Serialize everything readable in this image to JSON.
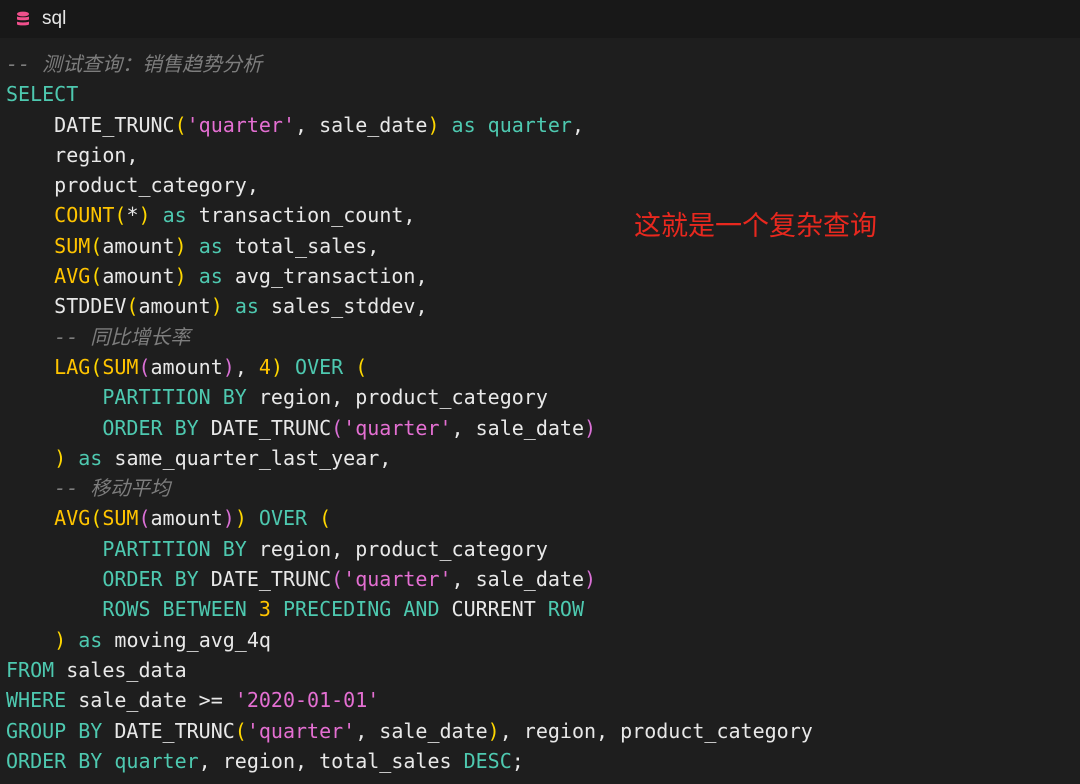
{
  "tab": {
    "icon": "database-icon",
    "label": "sql"
  },
  "annotation": "这就是一个复杂查询",
  "colors": {
    "background": "#1e1e1e",
    "titlebar": "#181818",
    "keyword": "#4ec9b0",
    "function": "#ffc400",
    "string": "#e46fd2",
    "comment": "#7d7d7d",
    "annotation": "#e8281e"
  },
  "code": {
    "lines": [
      [
        {
          "t": "comment",
          "v": "-- 测试查询：销售趋势分析"
        }
      ],
      [
        {
          "t": "keyword",
          "v": "SELECT"
        }
      ],
      [
        {
          "t": "plain",
          "v": "    DATE_TRUNC"
        },
        {
          "t": "paren1",
          "v": "("
        },
        {
          "t": "string",
          "v": "'quarter'"
        },
        {
          "t": "plain",
          "v": ", sale_date"
        },
        {
          "t": "paren1",
          "v": ")"
        },
        {
          "t": "plain",
          "v": " "
        },
        {
          "t": "keyword",
          "v": "as quarter"
        },
        {
          "t": "plain",
          "v": ","
        }
      ],
      [
        {
          "t": "plain",
          "v": "    region,"
        }
      ],
      [
        {
          "t": "plain",
          "v": "    product_category,"
        }
      ],
      [
        {
          "t": "plain",
          "v": "    "
        },
        {
          "t": "func",
          "v": "COUNT"
        },
        {
          "t": "paren1",
          "v": "("
        },
        {
          "t": "plain",
          "v": "*"
        },
        {
          "t": "paren1",
          "v": ")"
        },
        {
          "t": "plain",
          "v": " "
        },
        {
          "t": "keyword",
          "v": "as"
        },
        {
          "t": "plain",
          "v": " transaction_count,"
        }
      ],
      [
        {
          "t": "plain",
          "v": "    "
        },
        {
          "t": "func",
          "v": "SUM"
        },
        {
          "t": "paren1",
          "v": "("
        },
        {
          "t": "plain",
          "v": "amount"
        },
        {
          "t": "paren1",
          "v": ")"
        },
        {
          "t": "plain",
          "v": " "
        },
        {
          "t": "keyword",
          "v": "as"
        },
        {
          "t": "plain",
          "v": " total_sales,"
        }
      ],
      [
        {
          "t": "plain",
          "v": "    "
        },
        {
          "t": "func",
          "v": "AVG"
        },
        {
          "t": "paren1",
          "v": "("
        },
        {
          "t": "plain",
          "v": "amount"
        },
        {
          "t": "paren1",
          "v": ")"
        },
        {
          "t": "plain",
          "v": " "
        },
        {
          "t": "keyword",
          "v": "as"
        },
        {
          "t": "plain",
          "v": " avg_transaction,"
        }
      ],
      [
        {
          "t": "plain",
          "v": "    STDDEV"
        },
        {
          "t": "paren1",
          "v": "("
        },
        {
          "t": "plain",
          "v": "amount"
        },
        {
          "t": "paren1",
          "v": ")"
        },
        {
          "t": "plain",
          "v": " "
        },
        {
          "t": "keyword",
          "v": "as"
        },
        {
          "t": "plain",
          "v": " sales_stddev,"
        }
      ],
      [
        {
          "t": "comment",
          "v": "    -- 同比增长率"
        }
      ],
      [
        {
          "t": "plain",
          "v": "    "
        },
        {
          "t": "func",
          "v": "LAG"
        },
        {
          "t": "paren1",
          "v": "("
        },
        {
          "t": "func",
          "v": "SUM"
        },
        {
          "t": "paren2",
          "v": "("
        },
        {
          "t": "plain",
          "v": "amount"
        },
        {
          "t": "paren2",
          "v": ")"
        },
        {
          "t": "plain",
          "v": ", "
        },
        {
          "t": "number",
          "v": "4"
        },
        {
          "t": "paren1",
          "v": ")"
        },
        {
          "t": "plain",
          "v": " "
        },
        {
          "t": "keyword",
          "v": "OVER"
        },
        {
          "t": "plain",
          "v": " "
        },
        {
          "t": "paren1",
          "v": "("
        }
      ],
      [
        {
          "t": "plain",
          "v": "        "
        },
        {
          "t": "keyword",
          "v": "PARTITION BY"
        },
        {
          "t": "plain",
          "v": " region, product_category"
        }
      ],
      [
        {
          "t": "plain",
          "v": "        "
        },
        {
          "t": "keyword",
          "v": "ORDER BY"
        },
        {
          "t": "plain",
          "v": " DATE_TRUNC"
        },
        {
          "t": "paren2",
          "v": "("
        },
        {
          "t": "string",
          "v": "'quarter'"
        },
        {
          "t": "plain",
          "v": ", sale_date"
        },
        {
          "t": "paren2",
          "v": ")"
        }
      ],
      [
        {
          "t": "plain",
          "v": "    "
        },
        {
          "t": "paren1",
          "v": ")"
        },
        {
          "t": "plain",
          "v": " "
        },
        {
          "t": "keyword",
          "v": "as"
        },
        {
          "t": "plain",
          "v": " same_quarter_last_year,"
        }
      ],
      [
        {
          "t": "comment",
          "v": "    -- 移动平均"
        }
      ],
      [
        {
          "t": "plain",
          "v": "    "
        },
        {
          "t": "func",
          "v": "AVG"
        },
        {
          "t": "paren1",
          "v": "("
        },
        {
          "t": "func",
          "v": "SUM"
        },
        {
          "t": "paren2",
          "v": "("
        },
        {
          "t": "plain",
          "v": "amount"
        },
        {
          "t": "paren2",
          "v": ")"
        },
        {
          "t": "paren1",
          "v": ")"
        },
        {
          "t": "plain",
          "v": " "
        },
        {
          "t": "keyword",
          "v": "OVER"
        },
        {
          "t": "plain",
          "v": " "
        },
        {
          "t": "paren1",
          "v": "("
        }
      ],
      [
        {
          "t": "plain",
          "v": "        "
        },
        {
          "t": "keyword",
          "v": "PARTITION BY"
        },
        {
          "t": "plain",
          "v": " region, product_category"
        }
      ],
      [
        {
          "t": "plain",
          "v": "        "
        },
        {
          "t": "keyword",
          "v": "ORDER BY"
        },
        {
          "t": "plain",
          "v": " DATE_TRUNC"
        },
        {
          "t": "paren2",
          "v": "("
        },
        {
          "t": "string",
          "v": "'quarter'"
        },
        {
          "t": "plain",
          "v": ", sale_date"
        },
        {
          "t": "paren2",
          "v": ")"
        }
      ],
      [
        {
          "t": "plain",
          "v": "        "
        },
        {
          "t": "keyword",
          "v": "ROWS BETWEEN"
        },
        {
          "t": "plain",
          "v": " "
        },
        {
          "t": "number",
          "v": "3"
        },
        {
          "t": "plain",
          "v": " "
        },
        {
          "t": "keyword",
          "v": "PRECEDING AND"
        },
        {
          "t": "plain",
          "v": " CURRENT "
        },
        {
          "t": "keyword",
          "v": "ROW"
        }
      ],
      [
        {
          "t": "plain",
          "v": "    "
        },
        {
          "t": "paren1",
          "v": ")"
        },
        {
          "t": "plain",
          "v": " "
        },
        {
          "t": "keyword",
          "v": "as"
        },
        {
          "t": "plain",
          "v": " moving_avg_4q"
        }
      ],
      [
        {
          "t": "keyword",
          "v": "FROM"
        },
        {
          "t": "plain",
          "v": " sales_data"
        }
      ],
      [
        {
          "t": "keyword",
          "v": "WHERE"
        },
        {
          "t": "plain",
          "v": " sale_date >= "
        },
        {
          "t": "string",
          "v": "'2020-01-01'"
        }
      ],
      [
        {
          "t": "keyword",
          "v": "GROUP BY"
        },
        {
          "t": "plain",
          "v": " DATE_TRUNC"
        },
        {
          "t": "paren1",
          "v": "("
        },
        {
          "t": "string",
          "v": "'quarter'"
        },
        {
          "t": "plain",
          "v": ", sale_date"
        },
        {
          "t": "paren1",
          "v": ")"
        },
        {
          "t": "plain",
          "v": ", region, product_category"
        }
      ],
      [
        {
          "t": "keyword",
          "v": "ORDER BY"
        },
        {
          "t": "plain",
          "v": " "
        },
        {
          "t": "keyword",
          "v": "quarter"
        },
        {
          "t": "plain",
          "v": ", region, total_sales "
        },
        {
          "t": "keyword",
          "v": "DESC"
        },
        {
          "t": "plain",
          "v": ";"
        }
      ]
    ]
  }
}
